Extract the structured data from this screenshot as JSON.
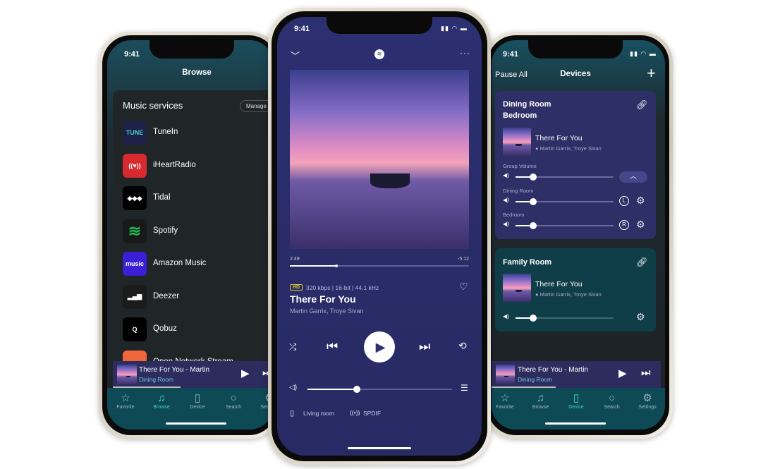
{
  "left_phone": {
    "time": "9:41",
    "title": "Browse",
    "section": "Music services",
    "manage": "Manage",
    "services": [
      {
        "name": "TuneIn",
        "icon": "tunein-logo",
        "color": "#1d2145"
      },
      {
        "name": "iHeartRadio",
        "icon": "iheartradio-logo",
        "color": "#d62a2f"
      },
      {
        "name": "Tidal",
        "icon": "tidal-logo",
        "color": "#000000"
      },
      {
        "name": "Spotify",
        "icon": "spotify-logo",
        "color": "#1db954"
      },
      {
        "name": "Amazon Music",
        "icon": "amazon-music-logo",
        "color": "#3a1fd6"
      },
      {
        "name": "Deezer",
        "icon": "deezer-logo",
        "color": "#1b1b1b"
      },
      {
        "name": "Qobuz",
        "icon": "qobuz-logo",
        "color": "#000000"
      },
      {
        "name": "Open Network Stream",
        "icon": "stream-logo",
        "color": "#f0663a"
      }
    ],
    "mini_player": {
      "title": "There For You - Martin",
      "room": "Dining Room",
      "progress": 0.4
    },
    "tabs": [
      {
        "label": "Favorite",
        "icon": "star-icon"
      },
      {
        "label": "Browse",
        "icon": "music-note-icon",
        "active": true
      },
      {
        "label": "Device",
        "icon": "device-icon"
      },
      {
        "label": "Search",
        "icon": "search-icon"
      },
      {
        "label": "Settings",
        "icon": "gear-icon"
      }
    ]
  },
  "center_phone": {
    "time": "9:41",
    "elapsed": "2:49",
    "remaining": "-5:12",
    "progress": 0.26,
    "quality_badge": "HD",
    "quality": "320 kbps | 16-bit | 44.1 kHz",
    "title": "There For You",
    "artist": "Martin Garrix, Troye Sivan",
    "volume": 0.34,
    "device": "Living room",
    "output": "SPDIF"
  },
  "right_phone": {
    "time": "9:41",
    "pause_all": "Pause All",
    "title": "Devices",
    "group": {
      "rooms": [
        "Dining Room",
        "Bedroom"
      ],
      "track": "There For You",
      "artist": "Martin Garrix, Troye Sivan",
      "group_volume_label": "Group Volume",
      "group_volume": 0.18,
      "members": [
        {
          "name": "Dining Room",
          "channel": "L",
          "volume": 0.18
        },
        {
          "name": "Bedroom",
          "channel": "R",
          "volume": 0.18
        }
      ]
    },
    "family": {
      "name": "Family Room",
      "track": "There For You",
      "artist": "Martin Garrix, Troye Sivan",
      "volume": 0.18
    },
    "mini_player": {
      "title": "There For You - Martin",
      "room": "Dining Room",
      "progress": 0.4
    },
    "tabs": [
      {
        "label": "Favorite",
        "icon": "star-icon"
      },
      {
        "label": "Browse",
        "icon": "music-note-icon"
      },
      {
        "label": "Device",
        "icon": "device-icon",
        "active": true
      },
      {
        "label": "Search",
        "icon": "search-icon"
      },
      {
        "label": "Settings",
        "icon": "gear-icon"
      }
    ]
  },
  "colors": {
    "accent": "#3fd3c4",
    "player_bg": "#2b2e6b",
    "card_group": "#2d2f66",
    "card_family": "#0f3e48",
    "tabbar": "#0e4a55"
  }
}
